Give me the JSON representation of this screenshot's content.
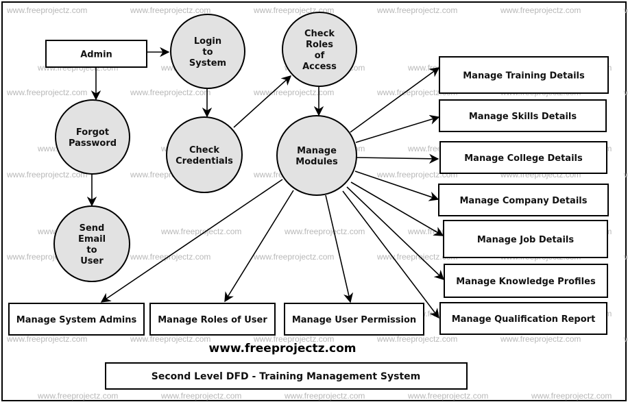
{
  "diagram": {
    "title": "Second Level DFD - Training Management System",
    "website": "www.freeprojectz.com",
    "watermark": "www.freeprojectz.com",
    "colors": {
      "process_fill": "#e2e2e2",
      "stroke": "#000000",
      "watermark": "#b8b8b8",
      "background": "#ffffff"
    },
    "entities": [
      {
        "id": "admin",
        "label": "Admin"
      }
    ],
    "processes": [
      {
        "id": "login",
        "lines": [
          "Login",
          "to",
          "System"
        ]
      },
      {
        "id": "check_roles",
        "lines": [
          "Check",
          "Roles",
          "of",
          "Access"
        ]
      },
      {
        "id": "forgot",
        "lines": [
          "Forgot",
          "Password"
        ]
      },
      {
        "id": "check_cred",
        "lines": [
          "Check",
          "Credentials"
        ]
      },
      {
        "id": "manage_modules",
        "lines": [
          "Manage",
          "Modules"
        ]
      },
      {
        "id": "send_email",
        "lines": [
          "Send",
          "Email",
          "to",
          "User"
        ]
      }
    ],
    "modules": [
      {
        "id": "training",
        "label": "Manage Training Details"
      },
      {
        "id": "skills",
        "label": "Manage Skills Details"
      },
      {
        "id": "college",
        "label": "Manage College Details"
      },
      {
        "id": "company",
        "label": "Manage Company Details"
      },
      {
        "id": "job",
        "label": "Manage Job Details"
      },
      {
        "id": "knowledge",
        "label": "Manage Knowledge Profiles"
      },
      {
        "id": "qualification",
        "label": "Manage Qualification Report"
      },
      {
        "id": "sysadmins",
        "label": "Manage System Admins"
      },
      {
        "id": "roles",
        "label": "Manage Roles of User"
      },
      {
        "id": "permission",
        "label": "Manage User Permission"
      }
    ],
    "flows": [
      {
        "from": "admin",
        "to": "login"
      },
      {
        "from": "admin",
        "to": "forgot"
      },
      {
        "from": "login",
        "to": "check_cred"
      },
      {
        "from": "check_cred",
        "to": "check_roles"
      },
      {
        "from": "check_roles",
        "to": "manage_modules"
      },
      {
        "from": "forgot",
        "to": "send_email"
      },
      {
        "from": "manage_modules",
        "to": "training"
      },
      {
        "from": "manage_modules",
        "to": "skills"
      },
      {
        "from": "manage_modules",
        "to": "college"
      },
      {
        "from": "manage_modules",
        "to": "company"
      },
      {
        "from": "manage_modules",
        "to": "job"
      },
      {
        "from": "manage_modules",
        "to": "knowledge"
      },
      {
        "from": "manage_modules",
        "to": "qualification"
      },
      {
        "from": "manage_modules",
        "to": "sysadmins"
      },
      {
        "from": "manage_modules",
        "to": "roles"
      },
      {
        "from": "manage_modules",
        "to": "permission"
      }
    ]
  }
}
